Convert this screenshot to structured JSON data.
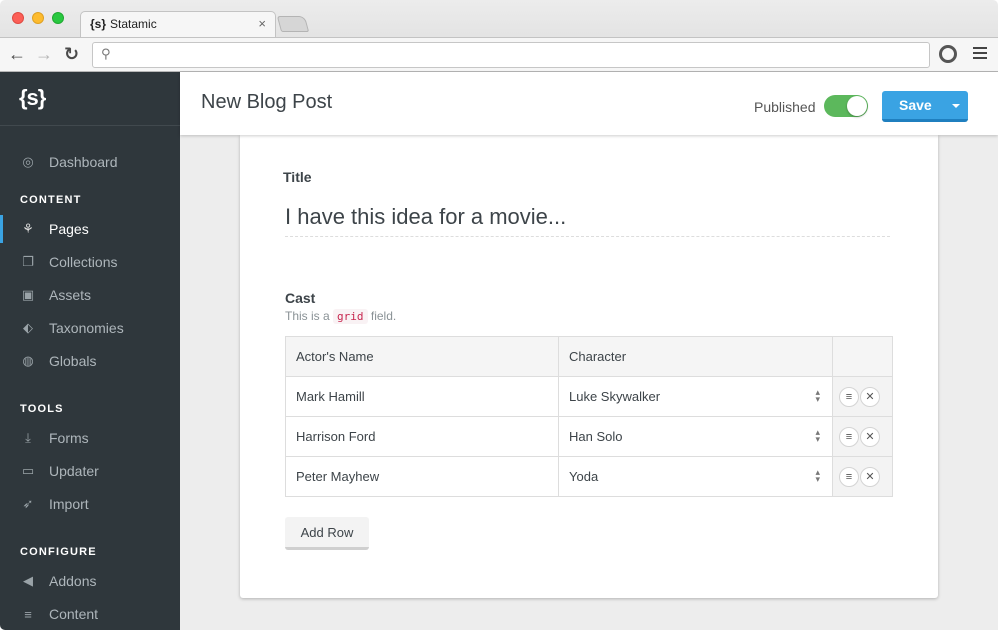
{
  "browser": {
    "tab_favicon": "{s}",
    "tab_title": "Statamic",
    "tab_close": "×",
    "url": "",
    "icons": {
      "back": "←",
      "forward": "→",
      "reload": "↻",
      "search": "⚲"
    }
  },
  "sidebar": {
    "logo": "{s}",
    "dashboard": {
      "label": "Dashboard",
      "icon": "◎"
    },
    "sections": [
      {
        "title": "CONTENT",
        "items": [
          {
            "label": "Pages",
            "icon": "⚘",
            "active": true
          },
          {
            "label": "Collections",
            "icon": "❐"
          },
          {
            "label": "Assets",
            "icon": "▣"
          },
          {
            "label": "Taxonomies",
            "icon": "⬖"
          },
          {
            "label": "Globals",
            "icon": "◍"
          }
        ]
      },
      {
        "title": "TOOLS",
        "items": [
          {
            "label": "Forms",
            "icon": "⤓"
          },
          {
            "label": "Updater",
            "icon": "▭"
          },
          {
            "label": "Import",
            "icon": "➶"
          }
        ]
      },
      {
        "title": "CONFIGURE",
        "items": [
          {
            "label": "Addons",
            "icon": "◀"
          },
          {
            "label": "Content",
            "icon": "≡"
          }
        ]
      }
    ]
  },
  "header": {
    "title": "New Blog Post",
    "published_label": "Published",
    "published": true,
    "save_label": "Save"
  },
  "form": {
    "title_label": "Title",
    "title_value": "I have this idea for a movie...",
    "cast_label": "Cast",
    "cast_help_prefix": "This is a",
    "cast_help_code": "grid",
    "cast_help_suffix": "field.",
    "grid": {
      "columns": [
        "Actor's Name",
        "Character"
      ],
      "rows": [
        {
          "actor": "Mark Hamill",
          "character": "Luke Skywalker"
        },
        {
          "actor": "Harrison Ford",
          "character": "Han Solo"
        },
        {
          "actor": "Peter Mayhew",
          "character": "Yoda"
        }
      ]
    },
    "add_row_label": "Add Row"
  },
  "colors": {
    "accent": "#3aa3e3",
    "toggle_on": "#5cb85c",
    "sidebar_bg": "#2f373c"
  }
}
